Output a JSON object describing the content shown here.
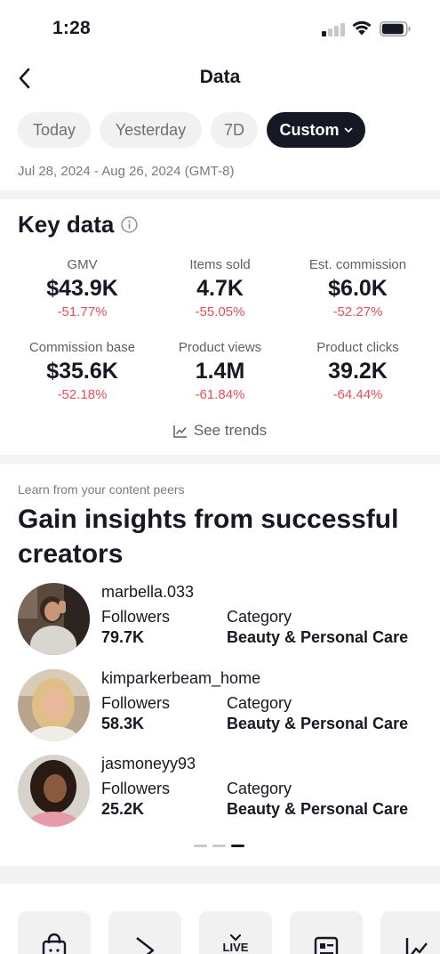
{
  "status_bar": {
    "time": "1:28"
  },
  "nav": {
    "title": "Data"
  },
  "filters": {
    "chips": [
      "Today",
      "Yesterday",
      "7D",
      "Custom"
    ],
    "selected": "Custom",
    "date_range": "Jul 28, 2024 - Aug 26, 2024 (GMT-8)"
  },
  "key_data": {
    "title": "Key data",
    "metrics": [
      {
        "label": "GMV",
        "value": "$43.9K",
        "change": "-51.77%"
      },
      {
        "label": "Items sold",
        "value": "4.7K",
        "change": "-55.05%"
      },
      {
        "label": "Est. commission",
        "value": "$6.0K",
        "change": "-52.27%"
      },
      {
        "label": "Commission base",
        "value": "$35.6K",
        "change": "-52.18%"
      },
      {
        "label": "Product views",
        "value": "1.4M",
        "change": "-61.84%"
      },
      {
        "label": "Product clicks",
        "value": "39.2K",
        "change": "-64.44%"
      }
    ],
    "see_trends": "See trends"
  },
  "peers": {
    "caption": "Learn from your content peers",
    "title": "Gain insights from successful creators",
    "creators": [
      {
        "name": "marbella.033",
        "followers_label": "Followers",
        "followers": "79.7K",
        "category_label": "Category",
        "category": "Beauty & Personal Care"
      },
      {
        "name": "kimparkerbeam_home",
        "followers_label": "Followers",
        "followers": "58.3K",
        "category_label": "Category",
        "category": "Beauty & Personal Care"
      },
      {
        "name": "jasmoneyy93",
        "followers_label": "Followers",
        "followers": "25.2K",
        "category_label": "Category",
        "category": "Beauty & Personal Care"
      }
    ],
    "pager": {
      "pages": 3,
      "current": 3
    }
  },
  "tools": [
    {
      "icon": "shopping-bag-icon"
    },
    {
      "icon": "video-play-icon"
    },
    {
      "icon": "live-tv-icon",
      "label": "LIVE"
    },
    {
      "icon": "profile-card-icon"
    },
    {
      "icon": "trend-chart-icon"
    }
  ],
  "colors": {
    "negative": "#e8505b",
    "active_chip": "#161823",
    "chip_bg": "#f1f1f2"
  }
}
